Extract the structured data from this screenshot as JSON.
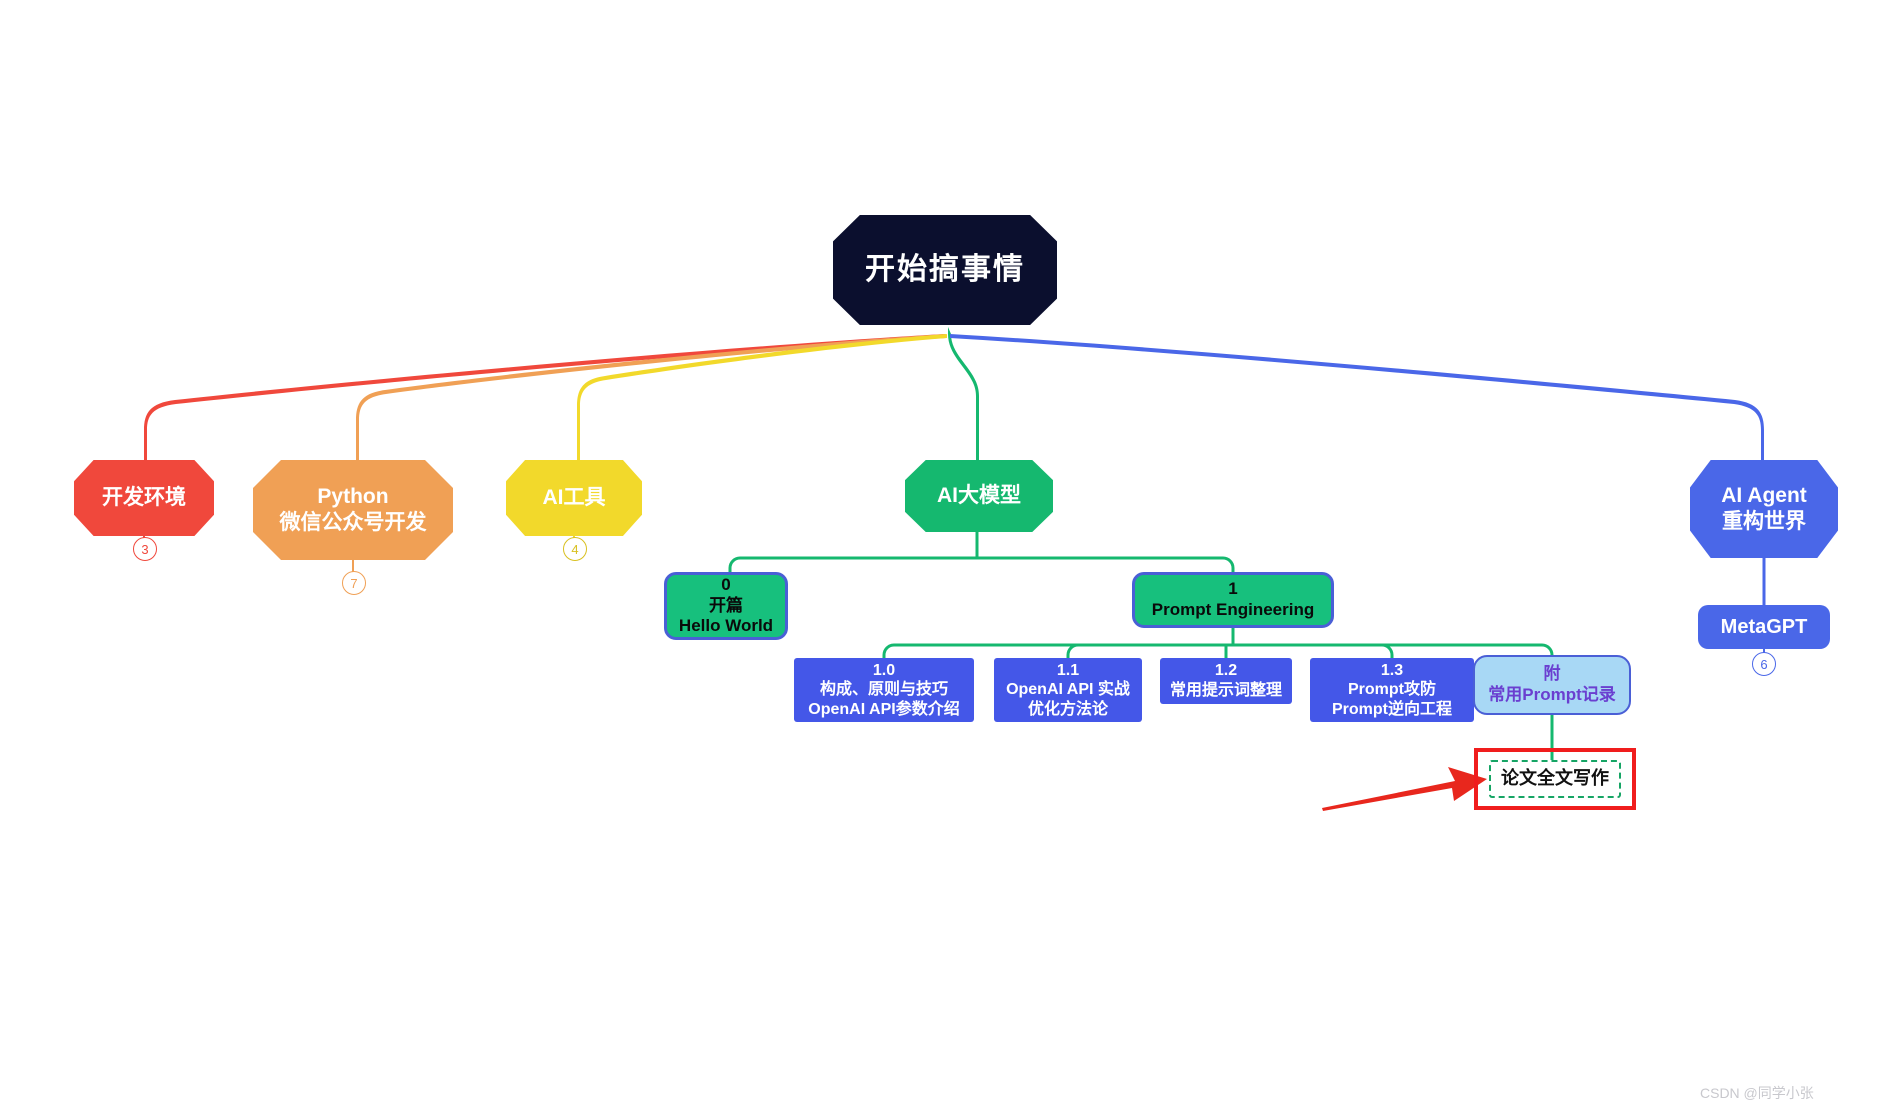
{
  "diagram": {
    "title_node": {
      "label": "开始搞事情",
      "color": "#0b0f2e"
    },
    "watermark": "CSDN @同学小张",
    "branches": [
      {
        "id": "dev",
        "label": "开发环境",
        "color": "#f0483c",
        "badge": "3"
      },
      {
        "id": "python",
        "line1": "Python",
        "line2": "微信公众号开发",
        "color": "#f0a055",
        "badge": "7"
      },
      {
        "id": "aitool",
        "label": "AI工具",
        "color": "#f2d92b",
        "badge": "4"
      },
      {
        "id": "llm",
        "label": "AI大模型",
        "color": "#15b86f"
      },
      {
        "id": "agent",
        "line1": "AI Agent",
        "line2": "重构世界",
        "color": "#4a67e8"
      }
    ],
    "metagpt": {
      "label": "MetaGPT",
      "badge": "6",
      "color": "#4a67e8"
    },
    "chapters": [
      {
        "id": "ch0",
        "num": "0",
        "line2": "开篇",
        "line3": "Hello World",
        "fill": "#17c07d",
        "border": "#4a5fd6"
      },
      {
        "id": "ch1",
        "num": "1",
        "line2": "Prompt Engineering",
        "fill": "#17c07d",
        "border": "#4a5fd6"
      }
    ],
    "leaves": [
      {
        "id": "l10",
        "num": "1.0",
        "line2": "构成、原则与技巧",
        "line3": "OpenAI API参数介绍",
        "color": "#4457e8"
      },
      {
        "id": "l11",
        "num": "1.1",
        "line2": "OpenAI API 实战",
        "line3": "优化方法论",
        "color": "#4457e8"
      },
      {
        "id": "l12",
        "num": "1.2",
        "line2": "常用提示词整理",
        "color": "#4457e8"
      },
      {
        "id": "l13",
        "num": "1.3",
        "line2": "Prompt攻防",
        "line3": "Prompt逆向工程",
        "color": "#4457e8"
      }
    ],
    "appendix": {
      "line1": "附",
      "line2": "常用Prompt记录",
      "fill": "#a8d8f5",
      "text_color": "#6a3fd0"
    },
    "highlighted": {
      "label": "论文全文写作",
      "highlight_color": "#f01d1d",
      "dash_color": "#16a565"
    }
  }
}
